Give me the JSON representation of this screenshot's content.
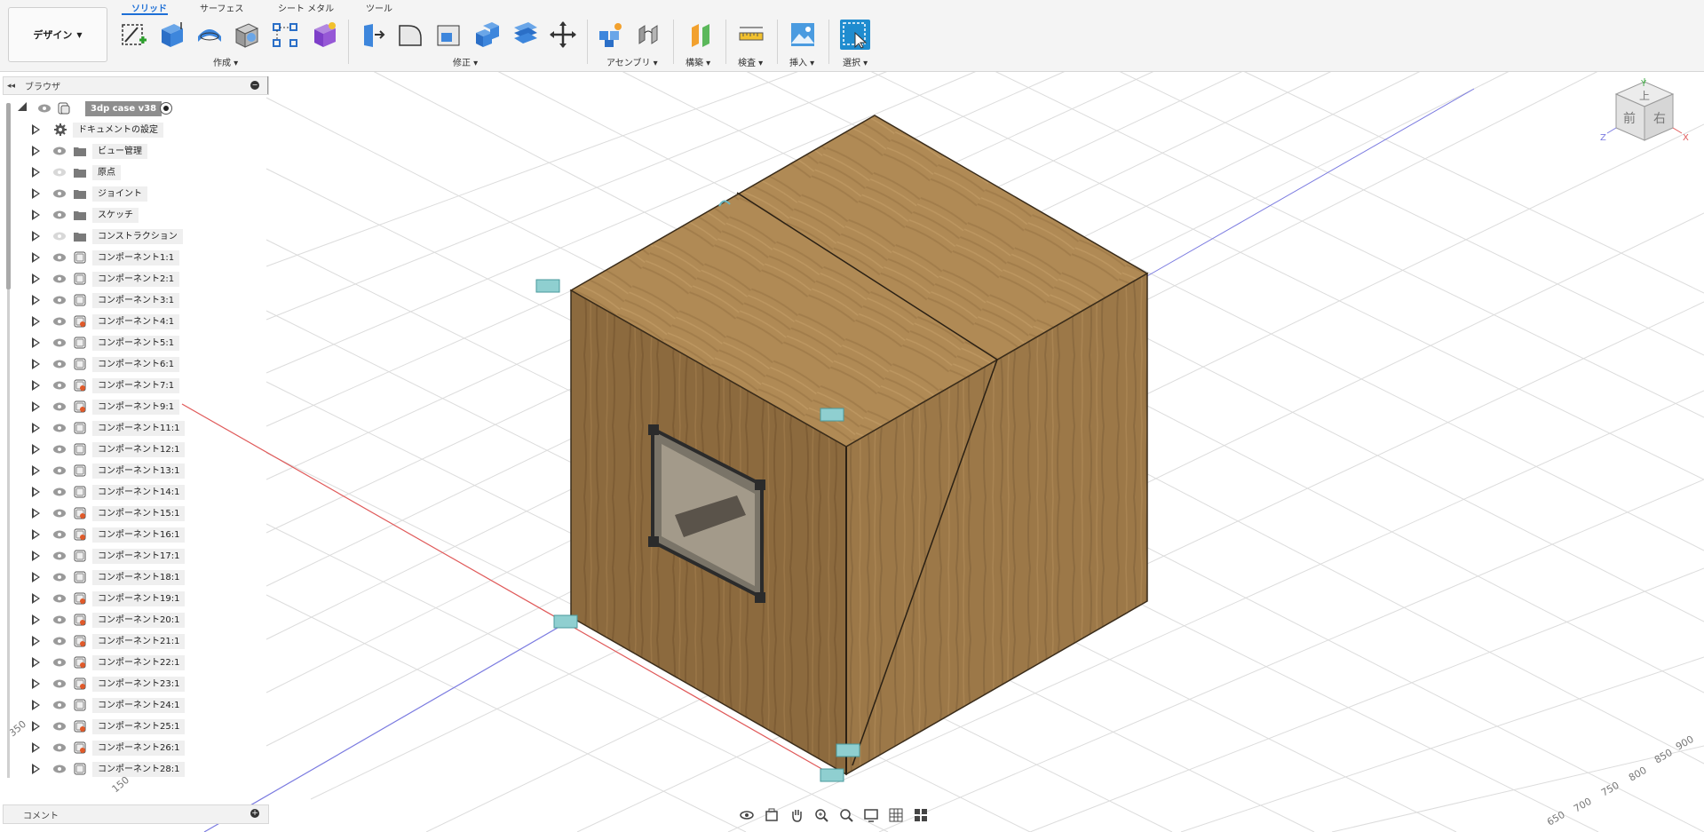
{
  "app": {
    "design_menu": "デザイン"
  },
  "tabs": [
    {
      "label": "ソリッド",
      "active": true
    },
    {
      "label": "サーフェス",
      "active": false
    },
    {
      "label": "シート メタル",
      "active": false
    },
    {
      "label": "ツール",
      "active": false
    }
  ],
  "toolbar_groups": [
    {
      "label": "作成"
    },
    {
      "label": "修正"
    },
    {
      "label": "アセンブリ"
    },
    {
      "label": "構築"
    },
    {
      "label": "検査"
    },
    {
      "label": "挿入"
    },
    {
      "label": "選択"
    }
  ],
  "browser": {
    "title": "ブラウザ",
    "root": "3dp case v38",
    "items": [
      {
        "label": "ドキュメントの設定",
        "icon": "gear-icon"
      },
      {
        "label": "ビュー管理",
        "icon": "folder-icon"
      },
      {
        "label": "原点",
        "icon": "folder-icon"
      },
      {
        "label": "ジョイント",
        "icon": "folder-icon"
      },
      {
        "label": "スケッチ",
        "icon": "folder-icon"
      },
      {
        "label": "コンストラクション",
        "icon": "folder-icon"
      },
      {
        "label": "コンポーネント1:1",
        "icon": "component-icon"
      },
      {
        "label": "コンポーネント2:1",
        "icon": "component-icon"
      },
      {
        "label": "コンポーネント3:1",
        "icon": "component-icon"
      },
      {
        "label": "コンポーネント4:1",
        "icon": "component-linked-icon"
      },
      {
        "label": "コンポーネント5:1",
        "icon": "component-icon"
      },
      {
        "label": "コンポーネント6:1",
        "icon": "component-icon"
      },
      {
        "label": "コンポーネント7:1",
        "icon": "component-linked-icon"
      },
      {
        "label": "コンポーネント9:1",
        "icon": "component-linked-icon"
      },
      {
        "label": "コンポーネント11:1",
        "icon": "component-icon"
      },
      {
        "label": "コンポーネント12:1",
        "icon": "component-icon"
      },
      {
        "label": "コンポーネント13:1",
        "icon": "component-icon"
      },
      {
        "label": "コンポーネント14:1",
        "icon": "component-icon"
      },
      {
        "label": "コンポーネント15:1",
        "icon": "component-linked-icon"
      },
      {
        "label": "コンポーネント16:1",
        "icon": "component-linked-icon"
      },
      {
        "label": "コンポーネント17:1",
        "icon": "component-icon"
      },
      {
        "label": "コンポーネント18:1",
        "icon": "component-icon"
      },
      {
        "label": "コンポーネント19:1",
        "icon": "component-linked-icon"
      },
      {
        "label": "コンポーネント20:1",
        "icon": "component-linked-icon"
      },
      {
        "label": "コンポーネント21:1",
        "icon": "component-linked-icon"
      },
      {
        "label": "コンポーネント22:1",
        "icon": "component-linked-icon"
      },
      {
        "label": "コンポーネント23:1",
        "icon": "component-linked-icon"
      },
      {
        "label": "コンポーネント24:1",
        "icon": "component-icon"
      },
      {
        "label": "コンポーネント25:1",
        "icon": "component-linked-icon"
      },
      {
        "label": "コンポーネント26:1",
        "icon": "component-linked-icon"
      },
      {
        "label": "コンポーネント28:1",
        "icon": "component-icon"
      }
    ]
  },
  "comments": {
    "label": "コメント"
  },
  "viewcube": {
    "top": "上",
    "front": "前",
    "right": "右",
    "axis_x": "X",
    "axis_y": "Y",
    "axis_z": "Z"
  },
  "ruler": {
    "labels": [
      "900",
      "850",
      "800",
      "750",
      "700",
      "650",
      "350",
      "150"
    ]
  },
  "colors": {
    "accent": "#1d6fd6",
    "wood_top": "#b08a55",
    "wood_left": "#8c6a3e",
    "wood_right": "#9c7848",
    "x_axis": "#e05a5a",
    "z_axis": "#7a7ae0"
  }
}
